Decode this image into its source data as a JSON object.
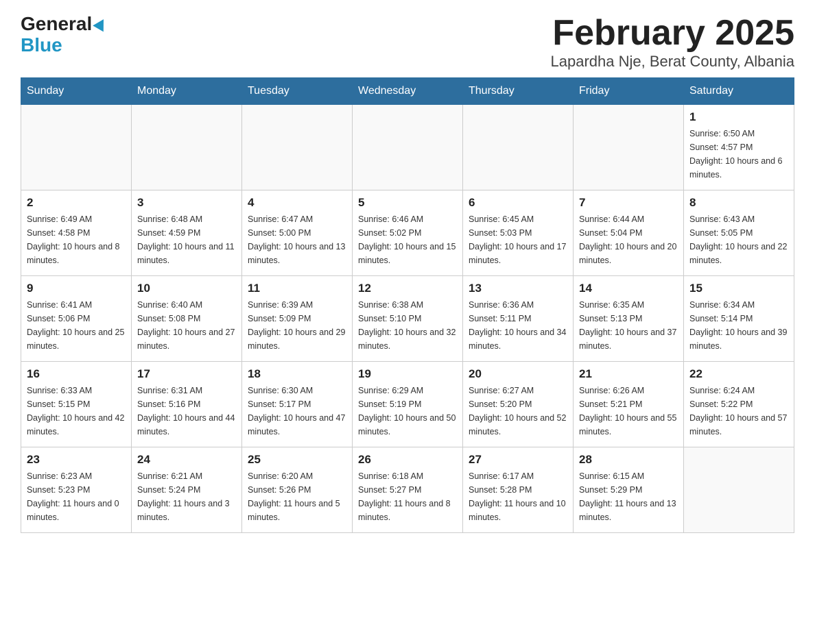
{
  "header": {
    "logo_general": "General",
    "logo_blue": "Blue",
    "title": "February 2025",
    "subtitle": "Lapardha Nje, Berat County, Albania"
  },
  "calendar": {
    "days_of_week": [
      "Sunday",
      "Monday",
      "Tuesday",
      "Wednesday",
      "Thursday",
      "Friday",
      "Saturday"
    ],
    "weeks": [
      [
        {
          "day": "",
          "info": ""
        },
        {
          "day": "",
          "info": ""
        },
        {
          "day": "",
          "info": ""
        },
        {
          "day": "",
          "info": ""
        },
        {
          "day": "",
          "info": ""
        },
        {
          "day": "",
          "info": ""
        },
        {
          "day": "1",
          "info": "Sunrise: 6:50 AM\nSunset: 4:57 PM\nDaylight: 10 hours and 6 minutes."
        }
      ],
      [
        {
          "day": "2",
          "info": "Sunrise: 6:49 AM\nSunset: 4:58 PM\nDaylight: 10 hours and 8 minutes."
        },
        {
          "day": "3",
          "info": "Sunrise: 6:48 AM\nSunset: 4:59 PM\nDaylight: 10 hours and 11 minutes."
        },
        {
          "day": "4",
          "info": "Sunrise: 6:47 AM\nSunset: 5:00 PM\nDaylight: 10 hours and 13 minutes."
        },
        {
          "day": "5",
          "info": "Sunrise: 6:46 AM\nSunset: 5:02 PM\nDaylight: 10 hours and 15 minutes."
        },
        {
          "day": "6",
          "info": "Sunrise: 6:45 AM\nSunset: 5:03 PM\nDaylight: 10 hours and 17 minutes."
        },
        {
          "day": "7",
          "info": "Sunrise: 6:44 AM\nSunset: 5:04 PM\nDaylight: 10 hours and 20 minutes."
        },
        {
          "day": "8",
          "info": "Sunrise: 6:43 AM\nSunset: 5:05 PM\nDaylight: 10 hours and 22 minutes."
        }
      ],
      [
        {
          "day": "9",
          "info": "Sunrise: 6:41 AM\nSunset: 5:06 PM\nDaylight: 10 hours and 25 minutes."
        },
        {
          "day": "10",
          "info": "Sunrise: 6:40 AM\nSunset: 5:08 PM\nDaylight: 10 hours and 27 minutes."
        },
        {
          "day": "11",
          "info": "Sunrise: 6:39 AM\nSunset: 5:09 PM\nDaylight: 10 hours and 29 minutes."
        },
        {
          "day": "12",
          "info": "Sunrise: 6:38 AM\nSunset: 5:10 PM\nDaylight: 10 hours and 32 minutes."
        },
        {
          "day": "13",
          "info": "Sunrise: 6:36 AM\nSunset: 5:11 PM\nDaylight: 10 hours and 34 minutes."
        },
        {
          "day": "14",
          "info": "Sunrise: 6:35 AM\nSunset: 5:13 PM\nDaylight: 10 hours and 37 minutes."
        },
        {
          "day": "15",
          "info": "Sunrise: 6:34 AM\nSunset: 5:14 PM\nDaylight: 10 hours and 39 minutes."
        }
      ],
      [
        {
          "day": "16",
          "info": "Sunrise: 6:33 AM\nSunset: 5:15 PM\nDaylight: 10 hours and 42 minutes."
        },
        {
          "day": "17",
          "info": "Sunrise: 6:31 AM\nSunset: 5:16 PM\nDaylight: 10 hours and 44 minutes."
        },
        {
          "day": "18",
          "info": "Sunrise: 6:30 AM\nSunset: 5:17 PM\nDaylight: 10 hours and 47 minutes."
        },
        {
          "day": "19",
          "info": "Sunrise: 6:29 AM\nSunset: 5:19 PM\nDaylight: 10 hours and 50 minutes."
        },
        {
          "day": "20",
          "info": "Sunrise: 6:27 AM\nSunset: 5:20 PM\nDaylight: 10 hours and 52 minutes."
        },
        {
          "day": "21",
          "info": "Sunrise: 6:26 AM\nSunset: 5:21 PM\nDaylight: 10 hours and 55 minutes."
        },
        {
          "day": "22",
          "info": "Sunrise: 6:24 AM\nSunset: 5:22 PM\nDaylight: 10 hours and 57 minutes."
        }
      ],
      [
        {
          "day": "23",
          "info": "Sunrise: 6:23 AM\nSunset: 5:23 PM\nDaylight: 11 hours and 0 minutes."
        },
        {
          "day": "24",
          "info": "Sunrise: 6:21 AM\nSunset: 5:24 PM\nDaylight: 11 hours and 3 minutes."
        },
        {
          "day": "25",
          "info": "Sunrise: 6:20 AM\nSunset: 5:26 PM\nDaylight: 11 hours and 5 minutes."
        },
        {
          "day": "26",
          "info": "Sunrise: 6:18 AM\nSunset: 5:27 PM\nDaylight: 11 hours and 8 minutes."
        },
        {
          "day": "27",
          "info": "Sunrise: 6:17 AM\nSunset: 5:28 PM\nDaylight: 11 hours and 10 minutes."
        },
        {
          "day": "28",
          "info": "Sunrise: 6:15 AM\nSunset: 5:29 PM\nDaylight: 11 hours and 13 minutes."
        },
        {
          "day": "",
          "info": ""
        }
      ]
    ]
  }
}
